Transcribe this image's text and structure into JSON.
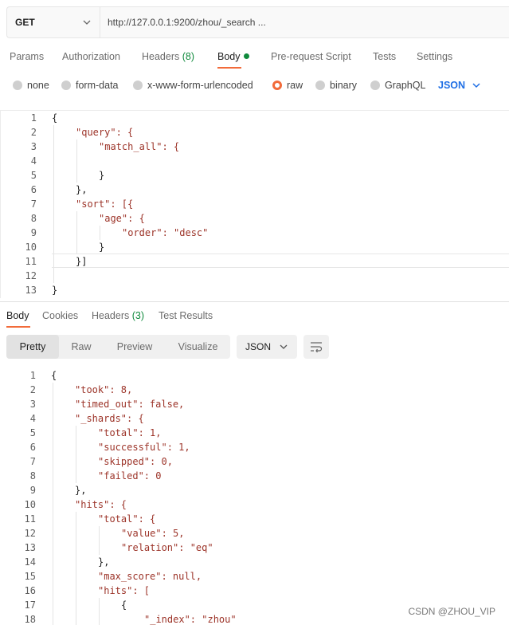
{
  "request": {
    "method": "GET",
    "url": "http://127.0.0.1:9200/zhou/_search ..."
  },
  "req_tabs": {
    "params": "Params",
    "authorization": "Authorization",
    "headers": "Headers",
    "headers_count": "(8)",
    "body": "Body",
    "prerequest": "Pre-request Script",
    "tests": "Tests",
    "settings": "Settings"
  },
  "body_types": {
    "none": "none",
    "form_data": "form-data",
    "urlencoded": "x-www-form-urlencoded",
    "raw": "raw",
    "binary": "binary",
    "graphql": "GraphQL",
    "format": "JSON",
    "selected": "raw"
  },
  "request_body": {
    "line_numbers": [
      "1",
      "2",
      "3",
      "4",
      "5",
      "6",
      "7",
      "8",
      "9",
      "10",
      "11",
      "12",
      "13"
    ],
    "lines": [
      "{",
      "\"query\": {",
      "\"match_all\": {",
      "",
      "}",
      "},",
      "\"sort\": [{",
      "\"age\": {",
      "\"order\": \"desc\"",
      "}",
      "}]",
      "",
      "}"
    ]
  },
  "resp_tabs": {
    "body": "Body",
    "cookies": "Cookies",
    "headers": "Headers",
    "headers_count": "(3)",
    "test_results": "Test Results"
  },
  "view_modes": {
    "pretty": "Pretty",
    "raw": "Raw",
    "preview": "Preview",
    "visualize": "Visualize",
    "format": "JSON"
  },
  "response_body": {
    "line_numbers": [
      "1",
      "2",
      "3",
      "4",
      "5",
      "6",
      "7",
      "8",
      "9",
      "10",
      "11",
      "12",
      "13",
      "14",
      "15",
      "16",
      "17",
      "18"
    ],
    "lines": [
      "{",
      "\"took\": 8,",
      "\"timed_out\": false,",
      "\"_shards\": {",
      "\"total\": 1,",
      "\"successful\": 1,",
      "\"skipped\": 0,",
      "\"failed\": 0",
      "},",
      "\"hits\": {",
      "\"total\": {",
      "\"value\": 5,",
      "\"relation\": \"eq\"",
      "},",
      "\"max_score\": null,",
      "\"hits\": [",
      "{",
      "\"_index\": \"zhou\""
    ]
  },
  "watermark": "CSDN @ZHOU_VIP",
  "colors": {
    "accent": "#f26b3a",
    "link": "#1f6fe5",
    "count": "#0f8a3c"
  }
}
